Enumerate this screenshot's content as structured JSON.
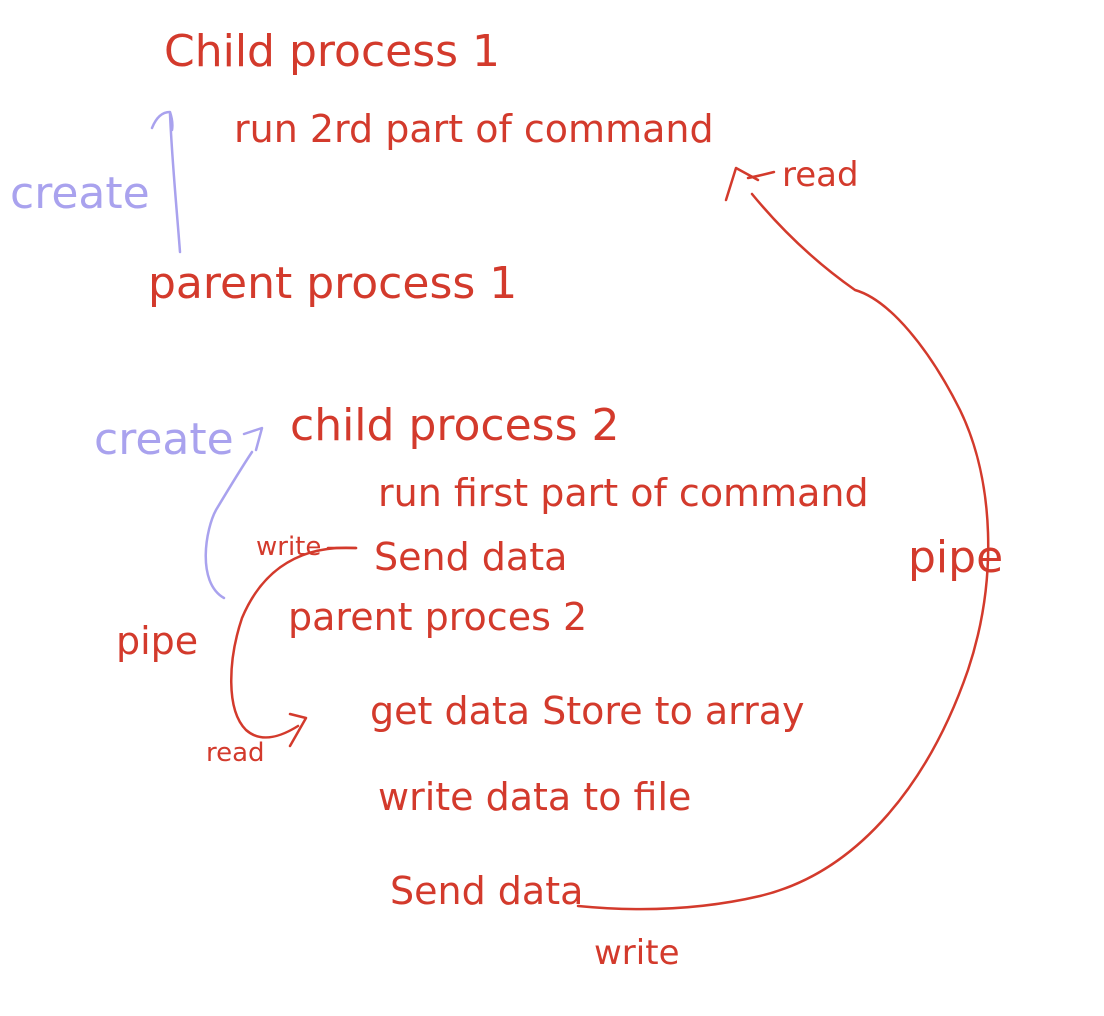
{
  "colors": {
    "ink_red": "#d33a2c",
    "ink_purple": "#a9a2ee",
    "background": "#ffffff"
  },
  "labels": {
    "child1": "Child process 1",
    "child1_task": "run 2rd part of command",
    "read_top": "read",
    "create_top": "create",
    "parent1": "parent process 1",
    "create_mid": "create",
    "child2": "child process 2",
    "child2_task": "run first part of command",
    "write_mid": "write",
    "send_data_1": "Send data",
    "pipe_right": "pipe",
    "pipe_left": "pipe",
    "parent2": "parent proces 2",
    "get_data": "get data Store to array",
    "read_bottom": "read",
    "write_file": "write data to file",
    "send_data_2": "Send data",
    "write_bottom": "write"
  }
}
